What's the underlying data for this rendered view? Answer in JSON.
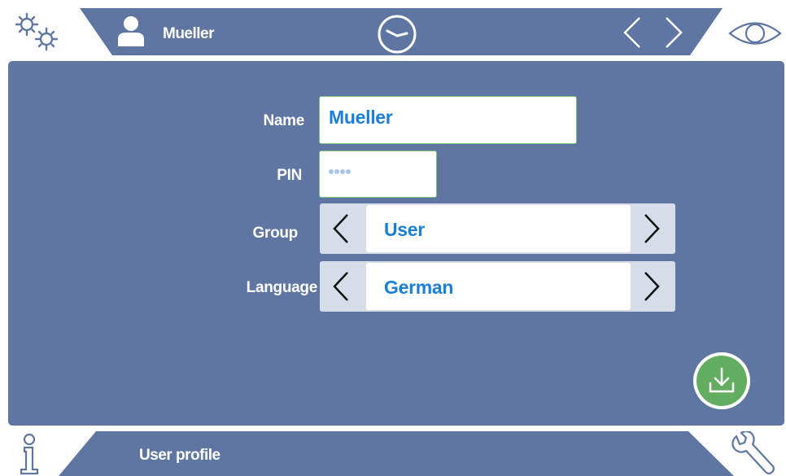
{
  "header": {
    "username": "Mueller",
    "icons": {
      "settings": "gears-icon",
      "user": "user-icon",
      "clock": "clock-icon",
      "prev": "chevron-left-icon",
      "next": "chevron-right-icon",
      "view": "eye-icon"
    }
  },
  "form": {
    "name_label": "Name",
    "name_value": "Mueller",
    "pin_label": "PIN",
    "pin_masked_length": 4,
    "group_label": "Group",
    "group_value": "User",
    "language_label": "Language",
    "language_value": "German"
  },
  "footer": {
    "title": "User profile",
    "icons": {
      "info": "info-icon",
      "service": "wrench-icon"
    }
  },
  "colors": {
    "bar_blue": "#5f76a3",
    "accent_text": "#1a7fd8",
    "save_green": "#63ad60",
    "selector_gray": "#d6dce8"
  }
}
